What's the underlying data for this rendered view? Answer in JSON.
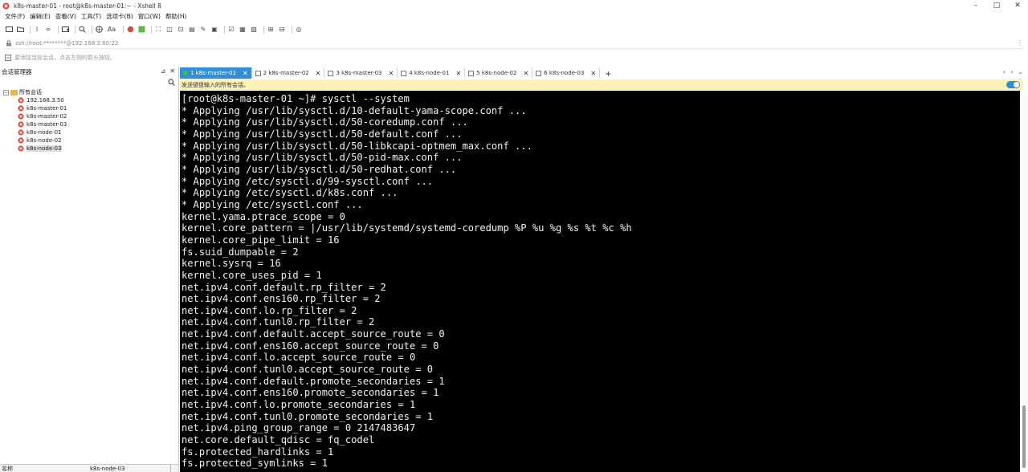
{
  "window": {
    "title": "k8s-master-01 - root@k8s-master-01:~ - Xshell 8",
    "controls": [
      "–",
      "□",
      "✕"
    ]
  },
  "menu": [
    "文件(F)",
    "编辑(E)",
    "查看(V)",
    "工具(T)",
    "选项卡(B)",
    "窗口(W)",
    "帮助(H)"
  ],
  "toolbar": {
    "font_label": "Aa"
  },
  "address": {
    "url": "ssh://root:********@192.168.3.80:22"
  },
  "hint": {
    "text": "要添加当前会话，点击左侧的箭头按钮。"
  },
  "session_panel": {
    "title": "会话管理器",
    "root_label": "所有会话",
    "items": [
      {
        "label": "192.168.3.50"
      },
      {
        "label": "k8s-master-01"
      },
      {
        "label": "k8s-master-02"
      },
      {
        "label": "k8s-master-03"
      },
      {
        "label": "k8s-node-01"
      },
      {
        "label": "k8s-node-02"
      },
      {
        "label": "k8s-node-03"
      }
    ],
    "footer": {
      "name_label": "名称",
      "name_value": "k8s-node-03"
    }
  },
  "tabs": [
    {
      "label": "1 k8s-master-01",
      "active": true
    },
    {
      "label": "2 k8s-master-02",
      "active": false
    },
    {
      "label": "3 k8s-master-03",
      "active": false
    },
    {
      "label": "4 k8s-node-01",
      "active": false
    },
    {
      "label": "5 k8s-node-02",
      "active": false
    },
    {
      "label": "6 k8s-node-03",
      "active": false
    }
  ],
  "notice": {
    "text": "发送键盘输入的所有会话。"
  },
  "terminal": {
    "lines": [
      "[root@k8s-master-01 ~]# sysctl --system",
      "* Applying /usr/lib/sysctl.d/10-default-yama-scope.conf ...",
      "* Applying /usr/lib/sysctl.d/50-coredump.conf ...",
      "* Applying /usr/lib/sysctl.d/50-default.conf ...",
      "* Applying /usr/lib/sysctl.d/50-libkcapi-optmem_max.conf ...",
      "* Applying /usr/lib/sysctl.d/50-pid-max.conf ...",
      "* Applying /usr/lib/sysctl.d/50-redhat.conf ...",
      "* Applying /etc/sysctl.d/99-sysctl.conf ...",
      "* Applying /etc/sysctl.d/k8s.conf ...",
      "* Applying /etc/sysctl.conf ...",
      "kernel.yama.ptrace_scope = 0",
      "kernel.core_pattern = |/usr/lib/systemd/systemd-coredump %P %u %g %s %t %c %h",
      "kernel.core_pipe_limit = 16",
      "fs.suid_dumpable = 2",
      "kernel.sysrq = 16",
      "kernel.core_uses_pid = 1",
      "net.ipv4.conf.default.rp_filter = 2",
      "net.ipv4.conf.ens160.rp_filter = 2",
      "net.ipv4.conf.lo.rp_filter = 2",
      "net.ipv4.conf.tunl0.rp_filter = 2",
      "net.ipv4.conf.default.accept_source_route = 0",
      "net.ipv4.conf.ens160.accept_source_route = 0",
      "net.ipv4.conf.lo.accept_source_route = 0",
      "net.ipv4.conf.tunl0.accept_source_route = 0",
      "net.ipv4.conf.default.promote_secondaries = 1",
      "net.ipv4.conf.ens160.promote_secondaries = 1",
      "net.ipv4.conf.lo.promote_secondaries = 1",
      "net.ipv4.conf.tunl0.promote_secondaries = 1",
      "net.ipv4.ping_group_range = 0 2147483647",
      "net.core.default_qdisc = fq_codel",
      "fs.protected_hardlinks = 1",
      "fs.protected_symlinks = 1"
    ]
  },
  "colors": {
    "accent": "#2f8fdb",
    "terminal_bg": "#000000",
    "terminal_fg": "#f2f2f2",
    "notice_bg": "#fdf2b6",
    "session_icon": "#e0473a",
    "connected_dot": "#35c24a"
  },
  "icons": {
    "app": "xshell-icon",
    "session": "terminal-session-icon",
    "folder": "folder-icon",
    "lock": "lock-icon",
    "search": "search-icon"
  }
}
